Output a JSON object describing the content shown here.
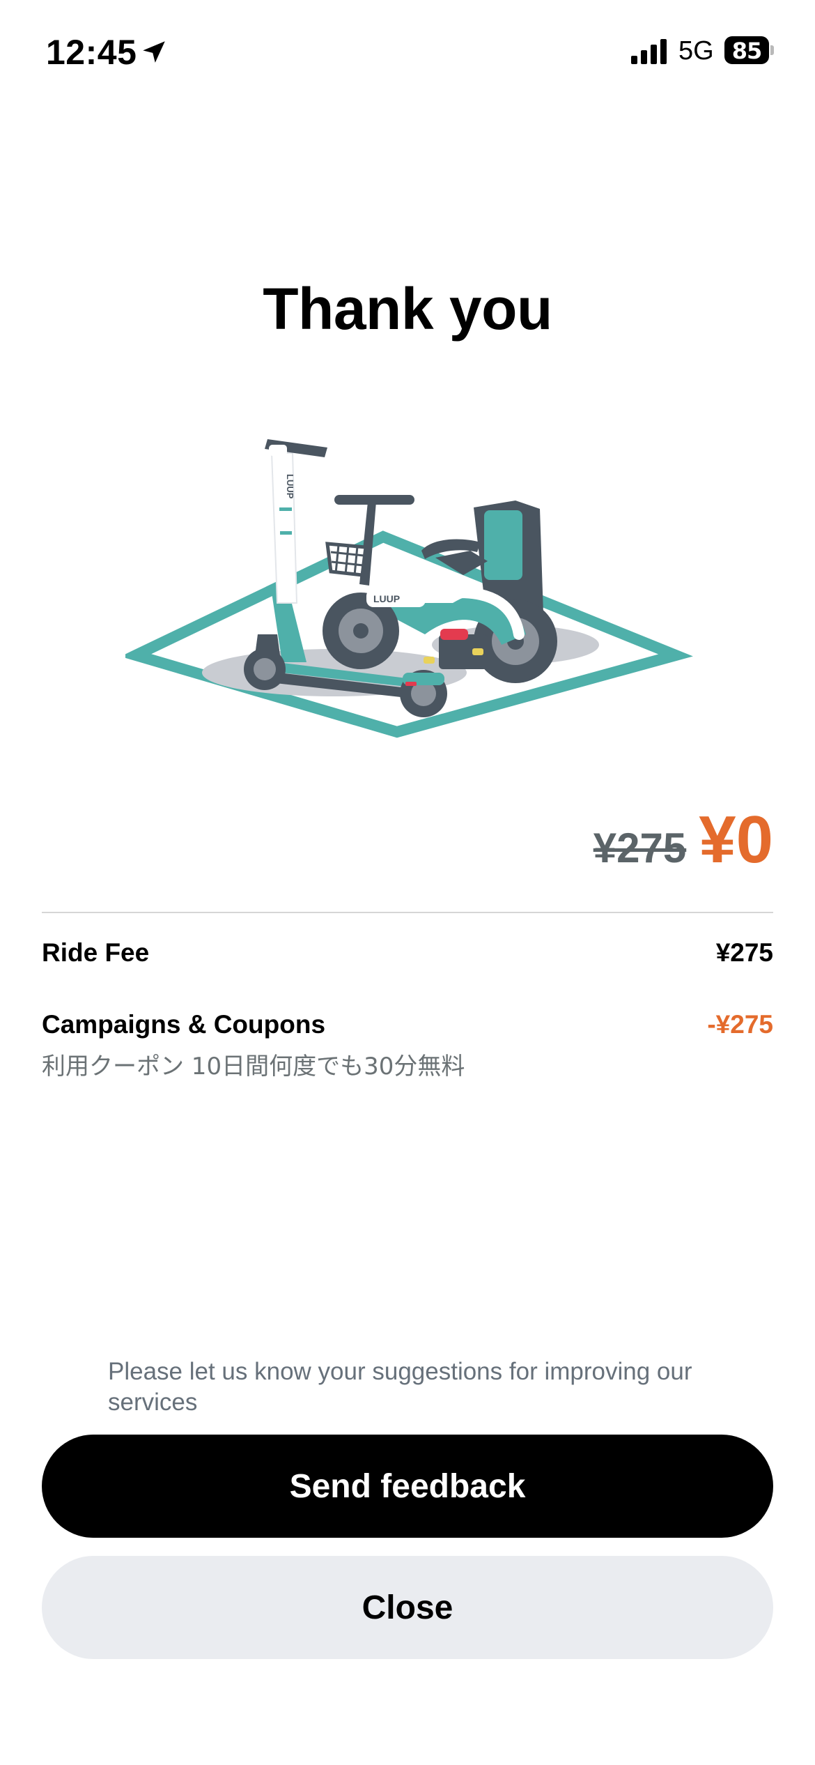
{
  "status_bar": {
    "time": "12:45",
    "network": "5G",
    "battery": "85",
    "icons": [
      "location-arrow-icon",
      "cellular-signal-icon",
      "battery-icon"
    ]
  },
  "title": "Thank you",
  "illustration": {
    "icon": "scooter-and-bike-parking-illustration",
    "brand_label": "LUUP"
  },
  "price": {
    "original": "¥275",
    "final": "¥0"
  },
  "breakdown": {
    "ride_fee_label": "Ride Fee",
    "ride_fee_value": "¥275",
    "coupons_label": "Campaigns & Coupons",
    "coupons_value": "-¥275",
    "coupons_desc": "利用クーポン 10日間何度でも30分無料"
  },
  "feedback_hint": "Please let us know your suggestions for improving our services",
  "buttons": {
    "feedback": "Send feedback",
    "close": "Close"
  },
  "colors": {
    "accent": "#e46b2c",
    "teal": "#4fb0aa",
    "dark": "#4a5560"
  }
}
